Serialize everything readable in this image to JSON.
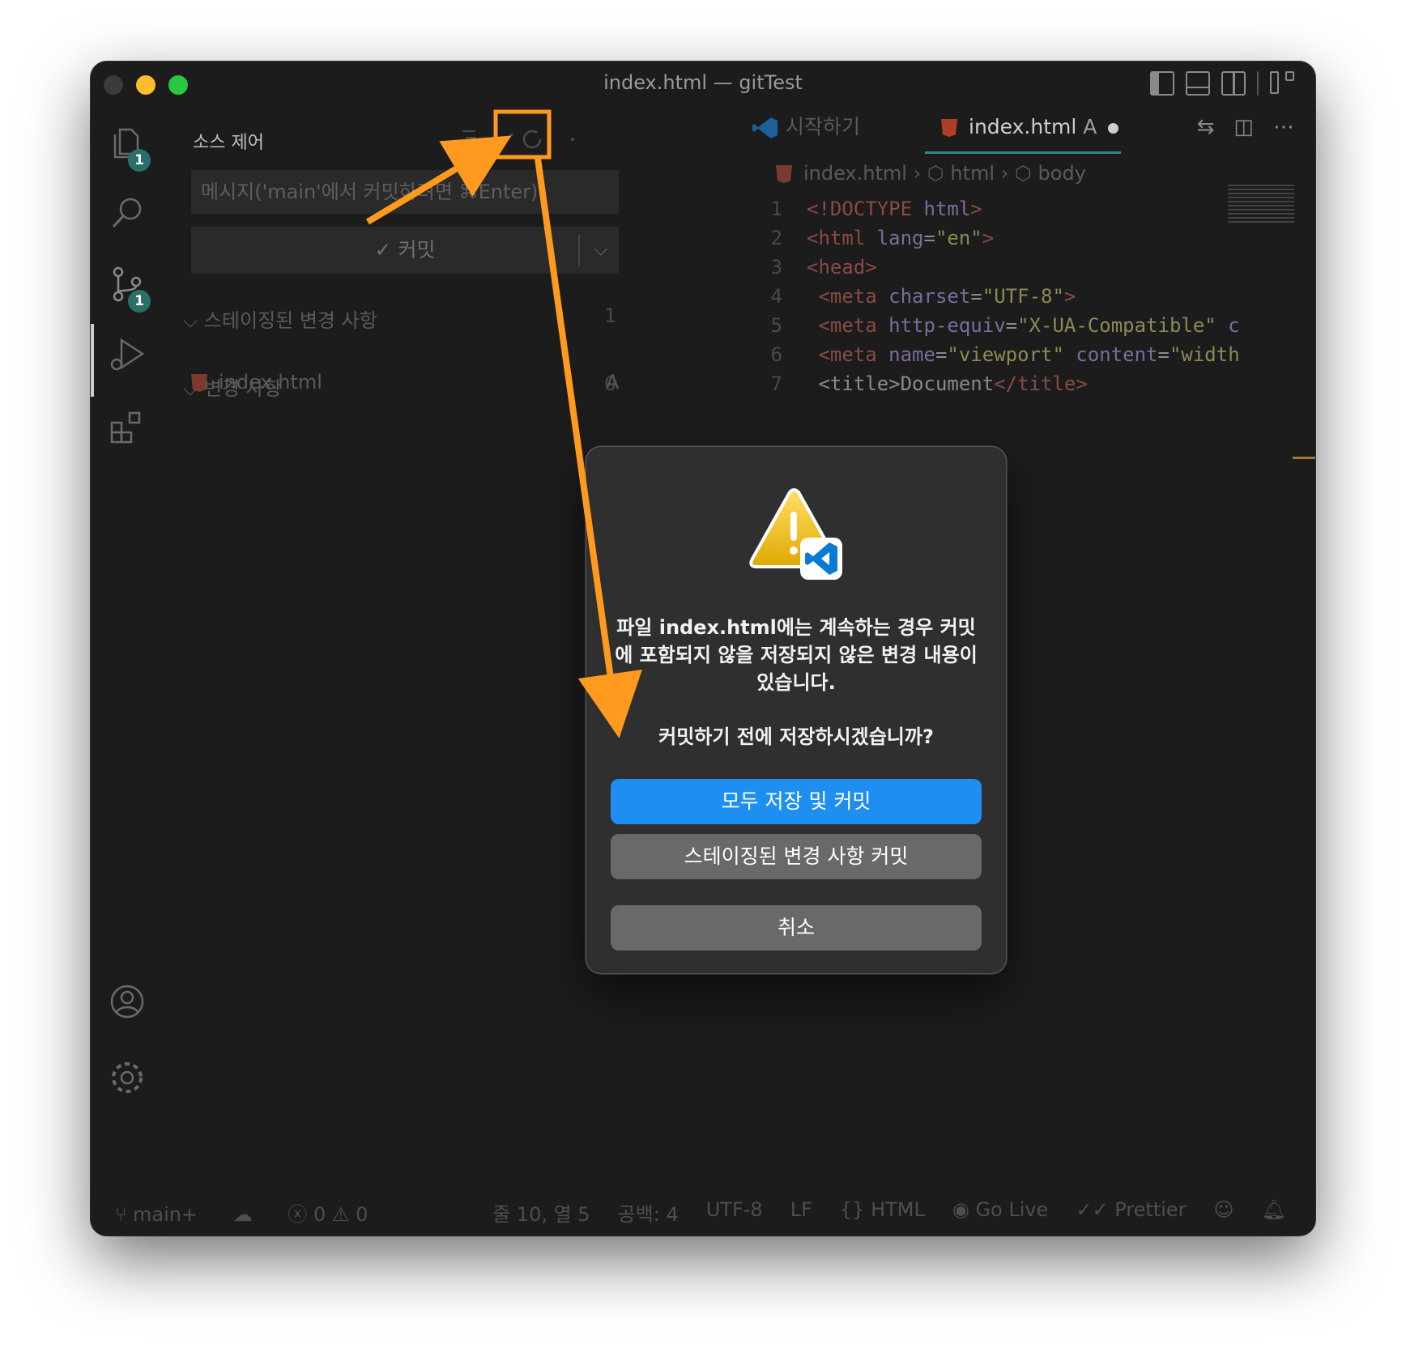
{
  "window": {
    "title": "index.html — gitTest"
  },
  "activity_bar": {
    "explorer_badge": "1",
    "scm_badge": "1"
  },
  "sidebar": {
    "title": "소스 제어",
    "commit_input_placeholder": "메시지('main'에서 커밋하려면 ⌘Enter)",
    "commit_button": "✓ 커밋",
    "staged_section": "스테이징된 변경 사항",
    "staged_count": "1",
    "staged_file": "index.html",
    "staged_file_status": "A",
    "changes_section": "변경 사항",
    "changes_count": "0"
  },
  "editor": {
    "tabs": [
      {
        "label": "시작하기"
      },
      {
        "label": "index.html",
        "status": "A"
      }
    ],
    "breadcrumb": [
      "index.html",
      "html",
      "body"
    ],
    "lines": [
      {
        "n": "1",
        "parts": [
          [
            "tg",
            "<!DOCTYPE "
          ],
          [
            "at",
            "html"
          ],
          [
            "tg",
            ">"
          ]
        ]
      },
      {
        "n": "2",
        "parts": [
          [
            "tg",
            "<html "
          ],
          [
            "at",
            "lang"
          ],
          [
            "tx",
            "="
          ],
          [
            "st",
            "\"en\""
          ],
          [
            "tg",
            ">"
          ]
        ]
      },
      {
        "n": "3",
        "parts": [
          [
            "tg",
            "<head>"
          ]
        ]
      },
      {
        "n": "4",
        "parts": [
          [
            "tx",
            "    "
          ],
          [
            "tg",
            "<meta "
          ],
          [
            "at",
            "charset"
          ],
          [
            "tx",
            "="
          ],
          [
            "st",
            "\"UTF-8\""
          ],
          [
            "tg",
            ">"
          ]
        ]
      },
      {
        "n": "5",
        "parts": [
          [
            "tx",
            "    "
          ],
          [
            "tg",
            "<meta "
          ],
          [
            "at",
            "http-equiv"
          ],
          [
            "tx",
            "="
          ],
          [
            "st",
            "\"X-UA-Compatible\""
          ],
          [
            "at",
            " c"
          ]
        ]
      },
      {
        "n": "6",
        "parts": [
          [
            "tx",
            "    "
          ],
          [
            "tg",
            "<meta "
          ],
          [
            "at",
            "name"
          ],
          [
            "tx",
            "="
          ],
          [
            "st",
            "\"viewport\""
          ],
          [
            "at",
            " content"
          ],
          [
            "tx",
            "="
          ],
          [
            "st",
            "\"width"
          ]
        ]
      },
      {
        "n": "7",
        "parts": [
          [
            "tx",
            "    <title>Document"
          ],
          [
            "tg",
            "</title>"
          ]
        ]
      }
    ]
  },
  "statusbar": {
    "branch": "main+",
    "errors": "0",
    "warnings": "0",
    "position": "줄 10, 열 5",
    "spaces": "공백: 4",
    "encoding": "UTF-8",
    "eol": "LF",
    "language": "HTML",
    "golive": "Go Live",
    "prettier": "Prettier"
  },
  "dialog": {
    "message": "파일 index.html에는 계속하는 경우 커밋에 포함되지 않을 저장되지 않은 변경 내용이 있습니다.",
    "question": "커밋하기 전에 저장하시겠습니까?",
    "primary_button": "모두 저장 및 커밋",
    "secondary_button": "스테이징된 변경 사항 커밋",
    "cancel_button": "취소"
  },
  "colors": {
    "accent": "#1e8ff0",
    "annotation": "#ff9a1f",
    "badge": "#2b6f6a"
  }
}
